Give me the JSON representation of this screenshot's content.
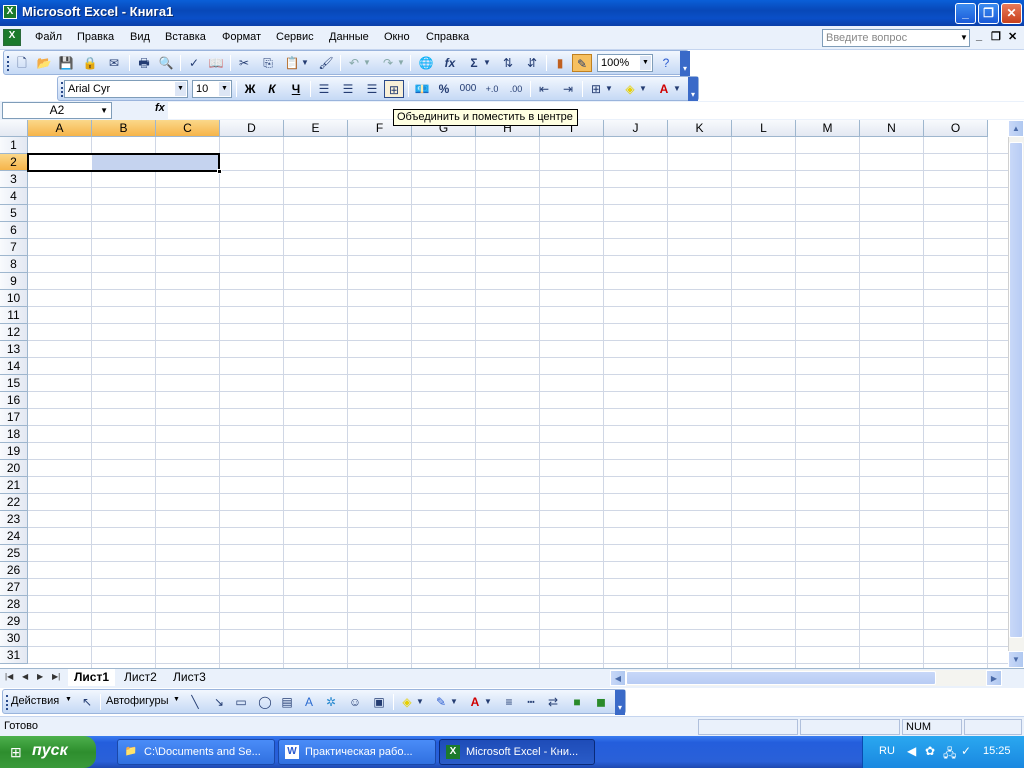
{
  "window": {
    "title": "Microsoft Excel - Книга1"
  },
  "menubar": {
    "items": [
      "Файл",
      "Правка",
      "Вид",
      "Вставка",
      "Формат",
      "Сервис",
      "Данные",
      "Окно",
      "Справка"
    ],
    "help_placeholder": "Введите вопрос"
  },
  "toolbar": {
    "zoom": "100%",
    "font_name": "Arial Cyr",
    "font_size": "10",
    "bold": "Ж",
    "italic": "К",
    "underline": "Ч",
    "percent": "%",
    "thousands": "000",
    "sigma": "Σ",
    "fx": "fx"
  },
  "formula_bar": {
    "name_box": "A2",
    "fx_label": "fx",
    "formula": ""
  },
  "tooltip": {
    "text": "Объединить и поместить в центре"
  },
  "grid": {
    "columns": [
      "A",
      "B",
      "C",
      "D",
      "E",
      "F",
      "G",
      "H",
      "I",
      "J",
      "K",
      "L",
      "M",
      "N",
      "O"
    ],
    "rows": [
      "1",
      "2",
      "3",
      "4",
      "5",
      "6",
      "7",
      "8",
      "9",
      "10",
      "11",
      "12",
      "13",
      "14",
      "15",
      "16",
      "17",
      "18",
      "19",
      "20",
      "21",
      "22",
      "23",
      "24",
      "25",
      "26",
      "27",
      "28",
      "29",
      "30",
      "31"
    ],
    "active_cell": "A2",
    "selection": "A2:C2"
  },
  "sheet_tabs": {
    "tabs": [
      "Лист1",
      "Лист2",
      "Лист3"
    ],
    "active": "Лист1"
  },
  "drawing_toolbar": {
    "actions": "Действия",
    "autoshapes": "Автофигуры"
  },
  "statusbar": {
    "status": "Готово",
    "num": "NUM"
  },
  "taskbar": {
    "start": "пуск",
    "tasks": [
      "C:\\Documents and Se...",
      "Практическая рабо...",
      "Microsoft Excel - Кни..."
    ],
    "active_task": 2,
    "lang": "RU",
    "clock": "15:25"
  },
  "colors": {
    "title_blue": "#0a5fd8",
    "toolbar_bg": "#eaf1fb",
    "selected_header": "#f6b44a",
    "selection_fill": "#c5d3ef",
    "start_green": "#2e8e2e"
  }
}
